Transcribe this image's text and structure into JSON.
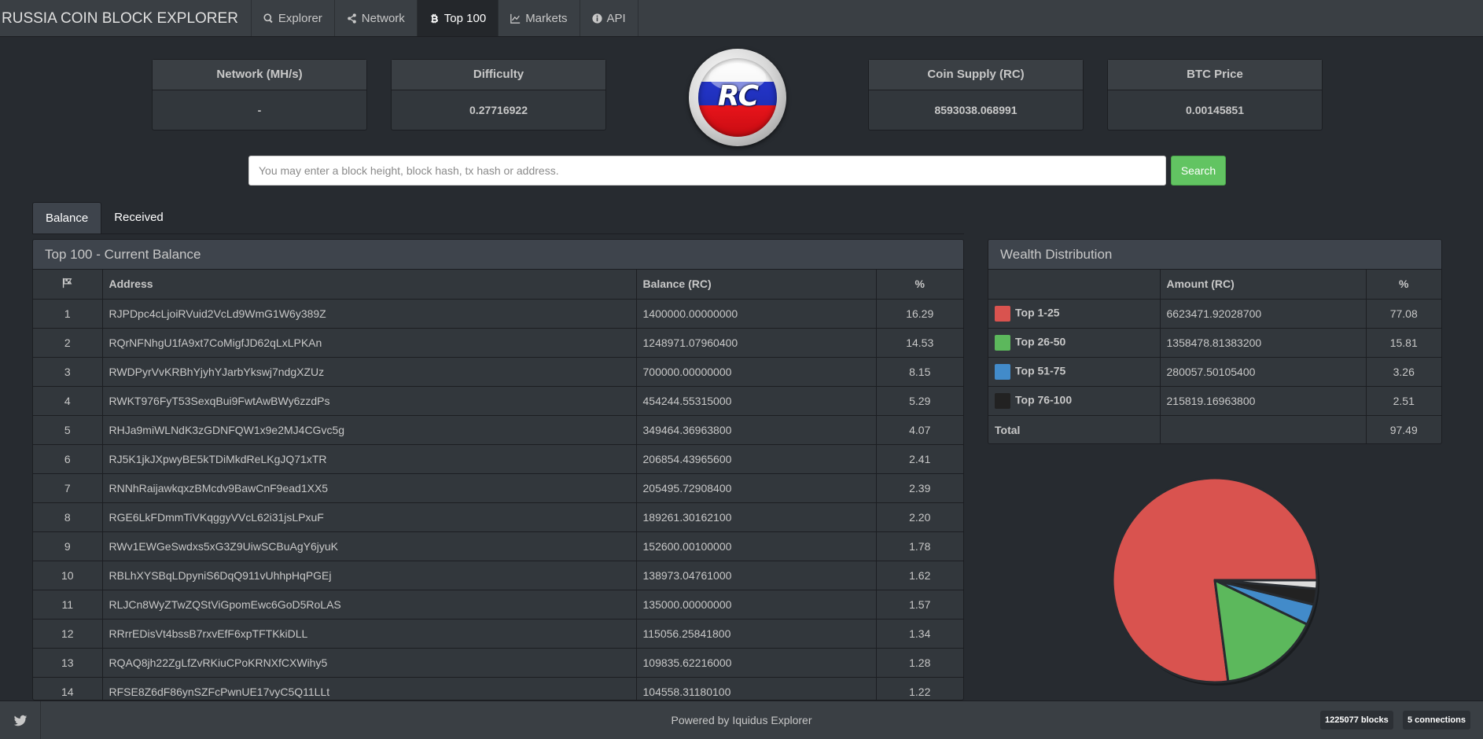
{
  "nav": {
    "brand": "RUSSIA COIN BLOCK EXPLORER",
    "items": [
      {
        "label": "Explorer",
        "icon": "search-icon"
      },
      {
        "label": "Network",
        "icon": "share-icon"
      },
      {
        "label": "Top 100",
        "icon": "bitcoin-icon"
      },
      {
        "label": "Markets",
        "icon": "line-chart-icon"
      },
      {
        "label": "API",
        "icon": "info-icon"
      }
    ],
    "active": "Top 100"
  },
  "stats": {
    "network": {
      "label": "Network (MH/s)",
      "value": "-"
    },
    "difficulty": {
      "label": "Difficulty",
      "value": "0.27716922"
    },
    "supply": {
      "label": "Coin Supply (RC)",
      "value": "8593038.068991"
    },
    "btc": {
      "label": "BTC Price",
      "value": "0.00145851"
    }
  },
  "logo": {
    "text": "RC"
  },
  "search": {
    "placeholder": "You may enter a block height, block hash, tx hash or address.",
    "button": "Search"
  },
  "tabs": [
    "Balance",
    "Received"
  ],
  "balance": {
    "title": "Top 100 - Current Balance",
    "columns": [
      "Address",
      "Balance (RC)",
      "%"
    ],
    "rows": [
      {
        "rank": "1",
        "address": "RJPDpc4cLjoiRVuid2VcLd9WmG1W6y389Z",
        "balance": "1400000.00000000",
        "pct": "16.29"
      },
      {
        "rank": "2",
        "address": "RQrNFNhgU1fA9xt7CoMigfJD62qLxLPKAn",
        "balance": "1248971.07960400",
        "pct": "14.53"
      },
      {
        "rank": "3",
        "address": "RWDPyrVvKRBhYjyhYJarbYkswj7ndgXZUz",
        "balance": "700000.00000000",
        "pct": "8.15"
      },
      {
        "rank": "4",
        "address": "RWKT976FyT53SexqBui9FwtAwBWy6zzdPs",
        "balance": "454244.55315000",
        "pct": "5.29"
      },
      {
        "rank": "5",
        "address": "RHJa9miWLNdK3zGDNFQW1x9e2MJ4CGvc5g",
        "balance": "349464.36963800",
        "pct": "4.07"
      },
      {
        "rank": "6",
        "address": "RJ5K1jkJXpwyBE5kTDiMkdReLKgJQ71xTR",
        "balance": "206854.43965600",
        "pct": "2.41"
      },
      {
        "rank": "7",
        "address": "RNNhRaijawkqxzBMcdv9BawCnF9ead1XX5",
        "balance": "205495.72908400",
        "pct": "2.39"
      },
      {
        "rank": "8",
        "address": "RGE6LkFDmmTiVKqggyVVcL62i31jsLPxuF",
        "balance": "189261.30162100",
        "pct": "2.20"
      },
      {
        "rank": "9",
        "address": "RWv1EWGeSwdxs5xG3Z9UiwSCBuAgY6jyuK",
        "balance": "152600.00100000",
        "pct": "1.78"
      },
      {
        "rank": "10",
        "address": "RBLhXYSBqLDpyniS6DqQ911vUhhpHqPGEj",
        "balance": "138973.04761000",
        "pct": "1.62"
      },
      {
        "rank": "11",
        "address": "RLJCn8WyZTwZQStViGpomEwc6GoD5RoLAS",
        "balance": "135000.00000000",
        "pct": "1.57"
      },
      {
        "rank": "12",
        "address": "RRrrEDisVt4bssB7rxvEfF6xpTFTKkiDLL",
        "balance": "115056.25841800",
        "pct": "1.34"
      },
      {
        "rank": "13",
        "address": "RQAQ8jh22ZgLfZvRKiuCPoKRNXfCXWihy5",
        "balance": "109835.62216000",
        "pct": "1.28"
      },
      {
        "rank": "14",
        "address": "RFSE8Z6dF86ynSZFcPwnUE17vyC5Q11LLt",
        "balance": "104558.31180100",
        "pct": "1.22"
      }
    ]
  },
  "wealth": {
    "title": "Wealth Distribution",
    "columns": [
      "",
      "Amount (RC)",
      "%"
    ],
    "rows": [
      {
        "label": "Top 1-25",
        "amount": "6623471.92028700",
        "pct": "77.08",
        "color": "#d9534f"
      },
      {
        "label": "Top 26-50",
        "amount": "1358478.81383200",
        "pct": "15.81",
        "color": "#5cb85c"
      },
      {
        "label": "Top 51-75",
        "amount": "280057.50105400",
        "pct": "3.26",
        "color": "#428bca"
      },
      {
        "label": "Top 76-100",
        "amount": "215819.16963800",
        "pct": "2.51",
        "color": "#222222"
      }
    ],
    "total": {
      "label": "Total",
      "pct": "97.49"
    }
  },
  "chart_data": {
    "type": "pie",
    "categories": [
      "Top 1-25",
      "Top 26-50",
      "Top 51-75",
      "Top 76-100",
      "Other"
    ],
    "values": [
      77.08,
      15.81,
      3.26,
      2.51,
      1.34
    ],
    "colors": [
      "#d9534f",
      "#5cb85c",
      "#428bca",
      "#222222",
      "#dddddd"
    ]
  },
  "footer": {
    "powered": "Powered by Iquidus Explorer",
    "blocks": "1225077 blocks",
    "connections": "5 connections"
  }
}
